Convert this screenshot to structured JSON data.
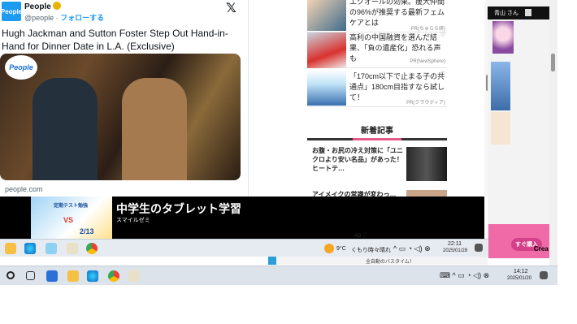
{
  "tweet": {
    "logo": "People",
    "name": "People",
    "handle": "@people",
    "separator": " · ",
    "follow": "フォローする",
    "x_icon": "𝕏",
    "title": "Hugh Jackman and Sutton Foster Step Out Hand-in-Hand for Dinner Date in L.A. (Exclusive)",
    "photo_logo": "People",
    "site": "people.com"
  },
  "sidebar": {
    "ads": [
      {
        "text": "エクオールの効果。痩大仲間の96%が推奨する最新フェムケアとは",
        "pr": "PR(ちゅらら研)"
      },
      {
        "text": "高利の中国融資を選んだ結果、「負の遺産化」恐れる声も",
        "pr": "PR(NewSphere)"
      },
      {
        "text": "「170cm以下で止まる子の共通点」180cm目指すなら試して！",
        "pr": "PR(クラウディア)"
      }
    ],
    "section_title": "新着記事",
    "news": [
      {
        "text": "お腹・お尻の冷え対策に「ユニクロより安い名品」があった！ ヒートテ…"
      },
      {
        "text": "アイメイクの常識が変わっ…"
      }
    ]
  },
  "peek": {
    "header_text": "青山 さん"
  },
  "banner": {
    "main": "中学生のタブレット学習",
    "sub": "スマイルゼミ",
    "thumb_caption": "定期テスト勉強",
    "thumb_vs": "VS",
    "thumb_date": "2/13",
    "ad_badge": "AD ⓘ"
  },
  "pink_ad": {
    "button": "すぐ購入",
    "cre": "Crea"
  },
  "taskbar_inner": {
    "weather_temp": "9°C",
    "weather_text": "くもり時々晴れ",
    "time": "22:11",
    "date": "2025/01/28",
    "colors": {
      "bg": "#dde3ea"
    }
  },
  "taskbar_outer": {
    "strip_text": "全自動のバスタイム！",
    "time": "14:12",
    "date": "2025/01/20"
  }
}
